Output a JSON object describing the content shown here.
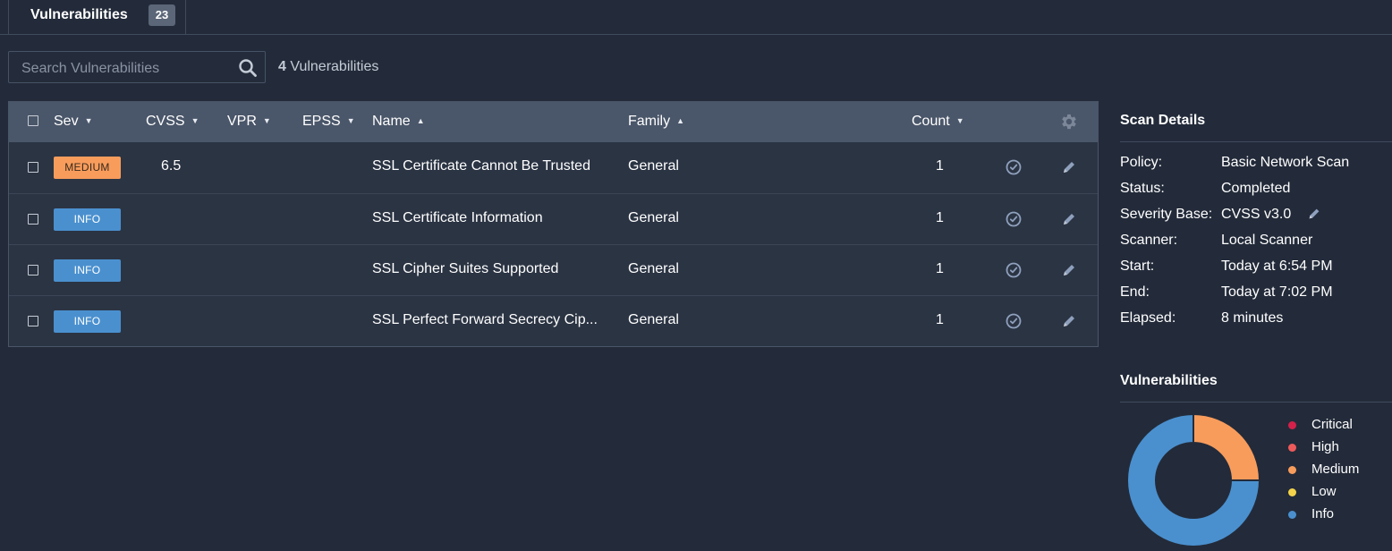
{
  "tab": {
    "label": "Vulnerabilities",
    "count": "23"
  },
  "search": {
    "placeholder": "Search Vulnerabilities"
  },
  "summary": {
    "count": "4",
    "label": "Vulnerabilities"
  },
  "columns": {
    "sev": "Sev",
    "cvss": "CVSS",
    "vpr": "VPR",
    "epss": "EPSS",
    "name": "Name",
    "family": "Family",
    "count": "Count"
  },
  "rows": [
    {
      "severity": "MEDIUM",
      "severity_color": "#f89c5c",
      "cvss": "6.5",
      "name": "SSL Certificate Cannot Be Trusted",
      "family": "General",
      "count": "1"
    },
    {
      "severity": "INFO",
      "severity_color": "#4a90cf",
      "cvss": "",
      "name": "SSL Certificate Information",
      "family": "General",
      "count": "1"
    },
    {
      "severity": "INFO",
      "severity_color": "#4a90cf",
      "cvss": "",
      "name": "SSL Cipher Suites Supported",
      "family": "General",
      "count": "1"
    },
    {
      "severity": "INFO",
      "severity_color": "#4a90cf",
      "cvss": "",
      "name": "SSL Perfect Forward Secrecy Cip...",
      "family": "General",
      "count": "1"
    }
  ],
  "scan_details": {
    "title": "Scan Details",
    "policy_label": "Policy:",
    "policy": "Basic Network Scan",
    "status_label": "Status:",
    "status": "Completed",
    "severity_base_label": "Severity Base:",
    "severity_base": "CVSS v3.0",
    "scanner_label": "Scanner:",
    "scanner": "Local Scanner",
    "start_label": "Start:",
    "start": "Today at 6:54 PM",
    "end_label": "End:",
    "end": "Today at 7:02 PM",
    "elapsed_label": "Elapsed:",
    "elapsed": "8 minutes"
  },
  "vuln_chart": {
    "title": "Vulnerabilities",
    "legend": [
      {
        "label": "Critical",
        "color": "#d4214a"
      },
      {
        "label": "High",
        "color": "#ee5a5a"
      },
      {
        "label": "Medium",
        "color": "#f89c5c"
      },
      {
        "label": "Low",
        "color": "#f5d34a"
      },
      {
        "label": "Info",
        "color": "#4a90cf"
      }
    ]
  },
  "chart_data": {
    "type": "pie",
    "categories": [
      "Critical",
      "High",
      "Medium",
      "Low",
      "Info"
    ],
    "values": [
      0,
      0,
      1,
      0,
      3
    ],
    "colors": [
      "#d4214a",
      "#ee5a5a",
      "#f89c5c",
      "#f5d34a",
      "#4a90cf"
    ],
    "title": "Vulnerabilities",
    "donut": true,
    "legend_position": "right"
  },
  "icons": {
    "search": "search-icon",
    "settings": "gear-icon",
    "snooze": "clock-check-icon",
    "edit": "pencil-icon"
  }
}
